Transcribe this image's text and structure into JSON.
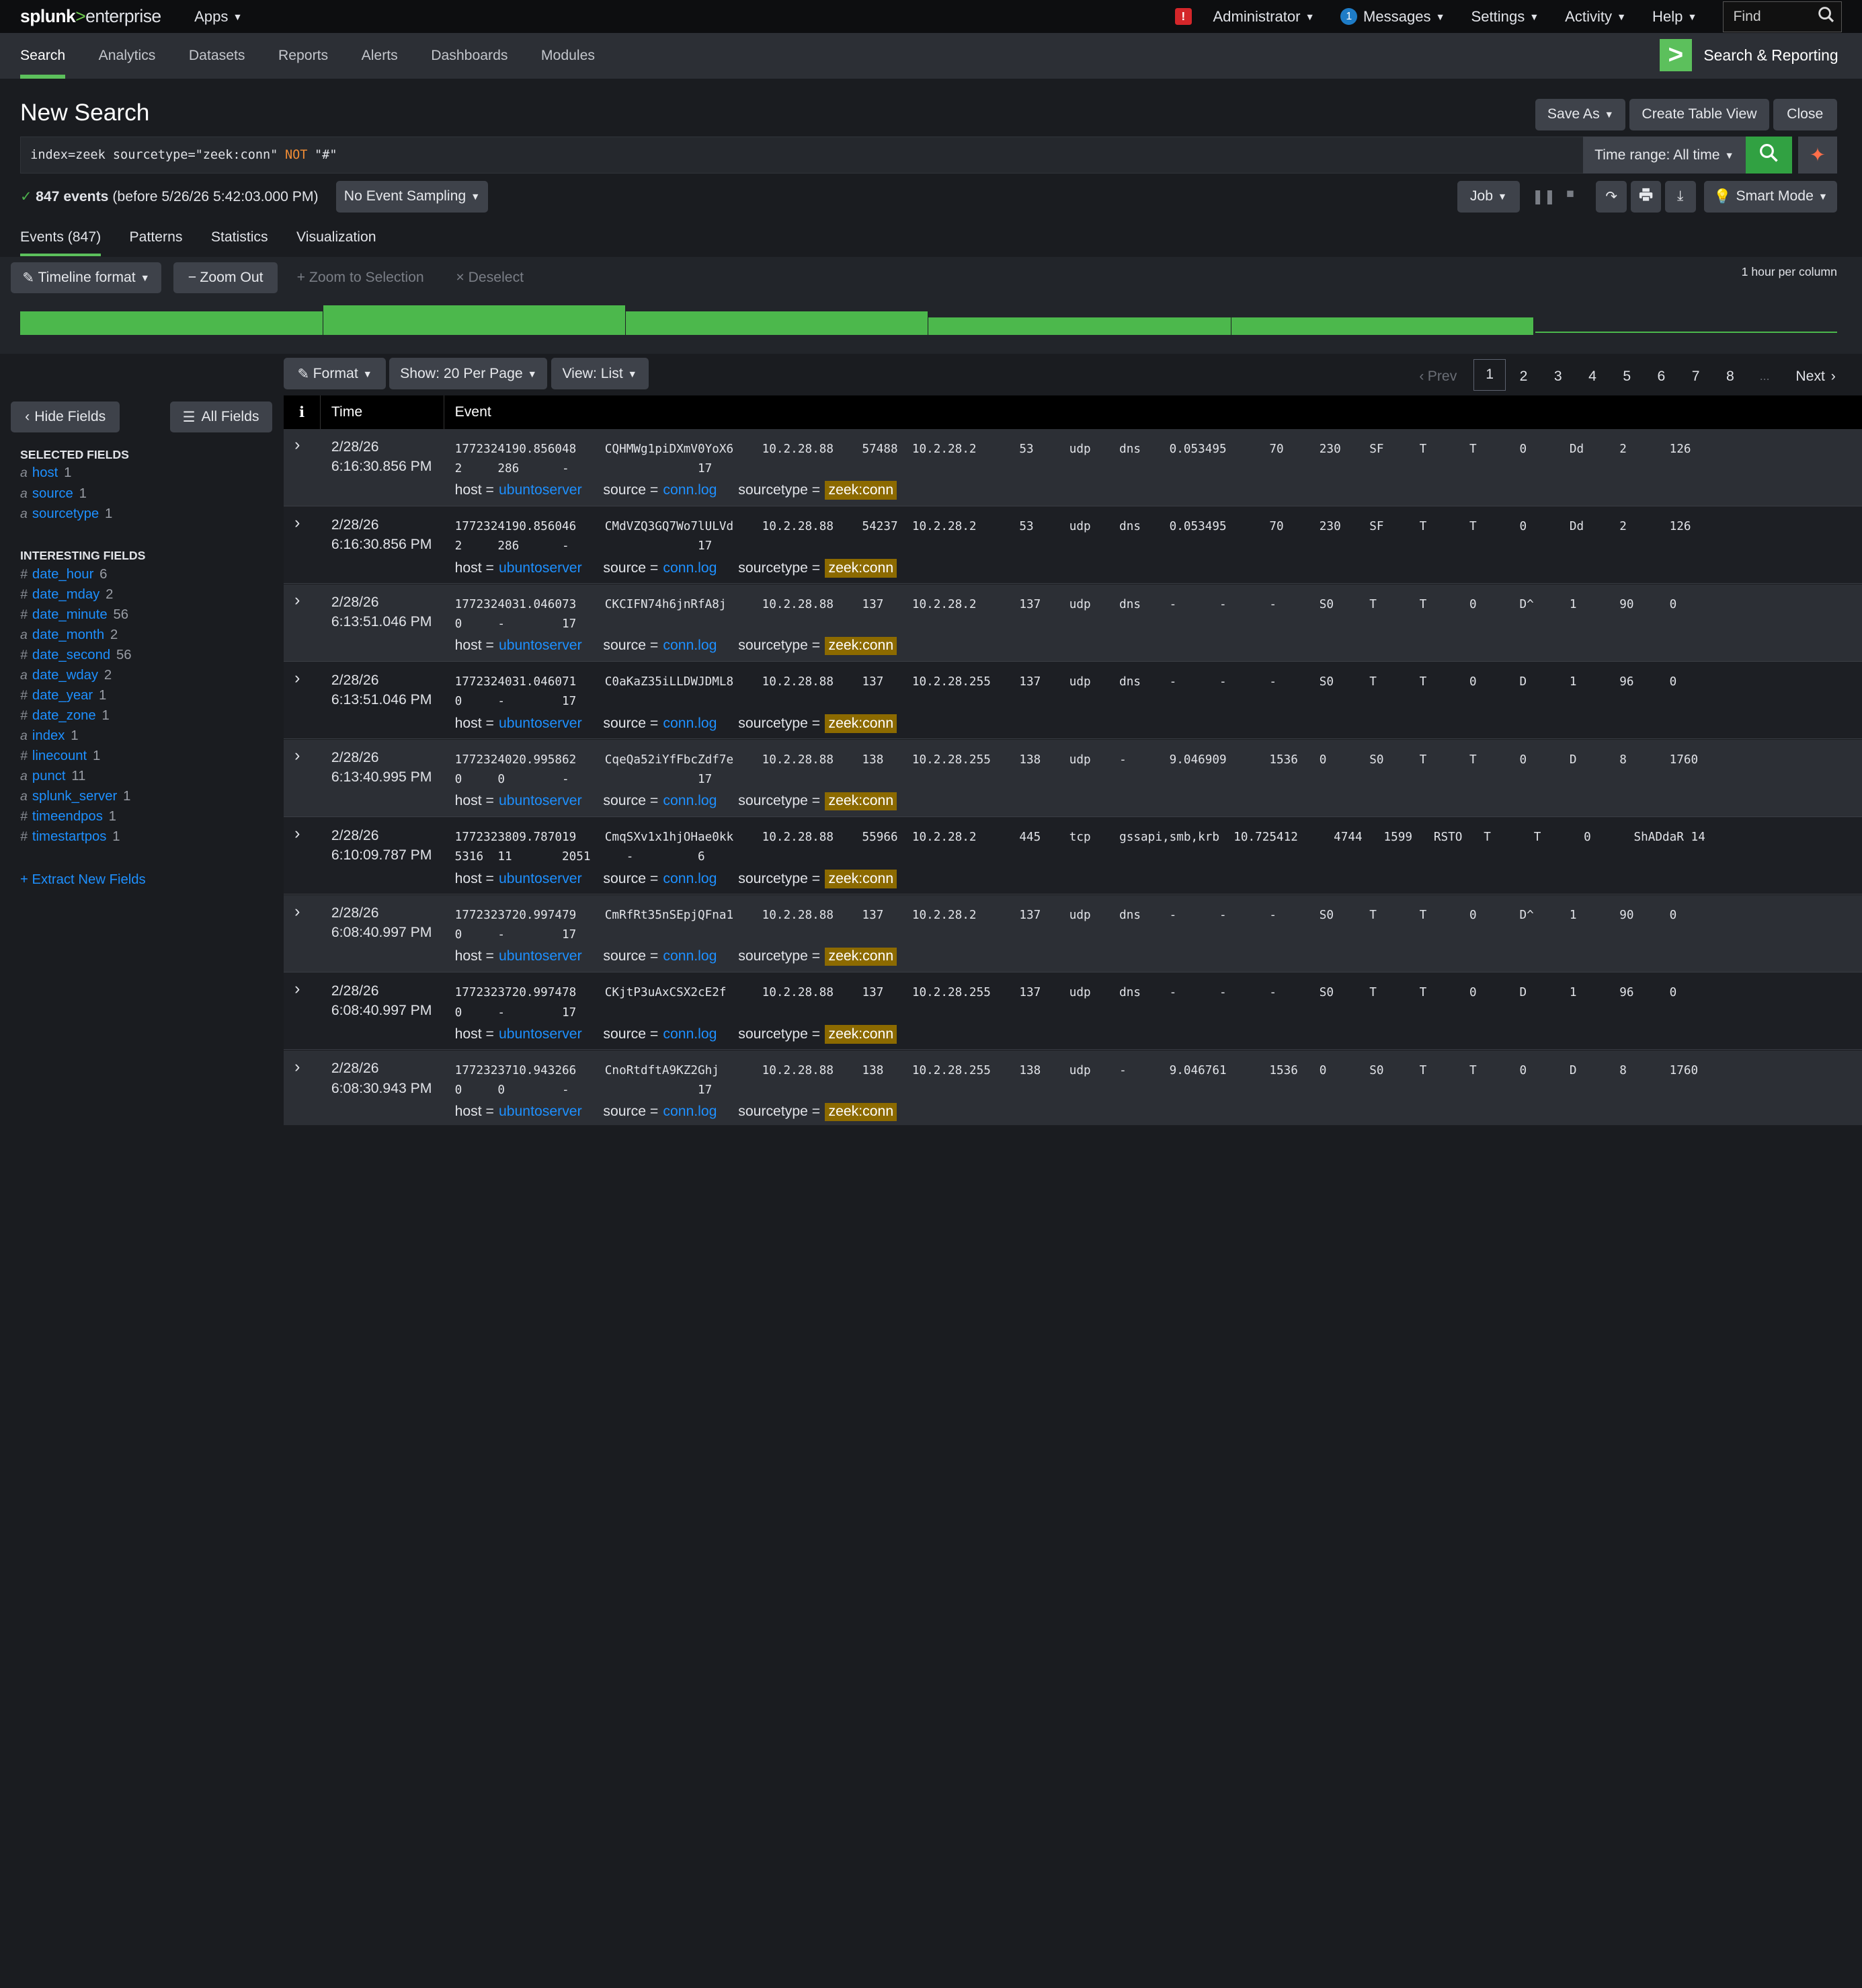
{
  "topbar": {
    "logo_brand": "splunk",
    "logo_sep": ">",
    "logo_product": "enterprise",
    "apps": "Apps",
    "alert_badge": "!",
    "admin": "Administrator",
    "messages_count": "1",
    "messages": "Messages",
    "settings": "Settings",
    "activity": "Activity",
    "help": "Help",
    "find": "Find"
  },
  "nav": {
    "tabs": [
      "Search",
      "Analytics",
      "Datasets",
      "Reports",
      "Alerts",
      "Dashboards",
      "Modules"
    ],
    "app_logo": ">",
    "app_name": "Search & Reporting"
  },
  "page": {
    "title": "New Search",
    "save_as": "Save As",
    "create_table_view": "Create Table View",
    "close": "Close"
  },
  "search": {
    "query_a": "index=zeek sourcetype=\"zeek:conn\"",
    "query_kw": "NOT",
    "query_b": "\"#\"",
    "time_range": "Time range: All time"
  },
  "status": {
    "count": "847 events",
    "detail": "(before 5/26/26 5:42:03.000 PM)",
    "sampling": "No Event Sampling",
    "job": "Job",
    "smart_mode": "Smart Mode"
  },
  "result_tabs": [
    "Events (847)",
    "Patterns",
    "Statistics",
    "Visualization"
  ],
  "timeline": {
    "format": "Timeline format",
    "zoom_out": "Zoom Out",
    "zoom_to_selection": "Zoom to Selection",
    "deselect": "Deselect",
    "hint": "1 hour per column",
    "bar_levels": [
      0.78,
      1.0,
      0.8,
      0.6,
      0.6,
      0.05
    ]
  },
  "pager": {
    "format": "Format",
    "per_page": "Show: 20 Per Page",
    "view": "View: List",
    "prev": "Prev",
    "pages": [
      "1",
      "2",
      "3",
      "4",
      "5",
      "6",
      "7",
      "8"
    ],
    "ellipsis": "...",
    "next": "Next"
  },
  "sidebar": {
    "hide_fields": "Hide Fields",
    "all_fields": "All Fields",
    "selected_header": "SELECTED FIELDS",
    "selected": [
      {
        "type": "a",
        "name": "host",
        "count": "1"
      },
      {
        "type": "a",
        "name": "source",
        "count": "1"
      },
      {
        "type": "a",
        "name": "sourcetype",
        "count": "1"
      }
    ],
    "interesting_header": "INTERESTING FIELDS",
    "interesting": [
      {
        "type": "#",
        "name": "date_hour",
        "count": "6"
      },
      {
        "type": "#",
        "name": "date_mday",
        "count": "2"
      },
      {
        "type": "#",
        "name": "date_minute",
        "count": "56"
      },
      {
        "type": "a",
        "name": "date_month",
        "count": "2"
      },
      {
        "type": "#",
        "name": "date_second",
        "count": "56"
      },
      {
        "type": "a",
        "name": "date_wday",
        "count": "2"
      },
      {
        "type": "#",
        "name": "date_year",
        "count": "1"
      },
      {
        "type": "#",
        "name": "date_zone",
        "count": "1"
      },
      {
        "type": "a",
        "name": "index",
        "count": "1"
      },
      {
        "type": "#",
        "name": "linecount",
        "count": "1"
      },
      {
        "type": "a",
        "name": "punct",
        "count": "11"
      },
      {
        "type": "a",
        "name": "splunk_server",
        "count": "1"
      },
      {
        "type": "#",
        "name": "timeendpos",
        "count": "1"
      },
      {
        "type": "#",
        "name": "timestartpos",
        "count": "1"
      }
    ],
    "extract": "+ Extract New Fields"
  },
  "table": {
    "col_i": "i",
    "col_time": "Time",
    "col_event": "Event",
    "meta_labels": {
      "host": "host =",
      "source": "source =",
      "sourcetype": "sourcetype ="
    },
    "rows": [
      {
        "date": "2/28/26",
        "time": "6:16:30.856 PM",
        "line1": "1772324190.856048    CQHMWg1piDXmV0YoX6    10.2.28.88    57488  10.2.28.2      53     udp    dns    0.053495      70     230    SF     T      T      0      Dd     2      126",
        "line2": "2     286      -                  17",
        "host": "ubuntoserver",
        "source": "conn.log",
        "sourcetype": "zeek:conn"
      },
      {
        "date": "2/28/26",
        "time": "6:16:30.856 PM",
        "line1": "1772324190.856046    CMdVZQ3GQ7Wo7lULVd    10.2.28.88    54237  10.2.28.2      53     udp    dns    0.053495      70     230    SF     T      T      0      Dd     2      126",
        "line2": "2     286      -                  17",
        "host": "ubuntoserver",
        "source": "conn.log",
        "sourcetype": "zeek:conn"
      },
      {
        "date": "2/28/26",
        "time": "6:13:51.046 PM",
        "line1": "1772324031.046073    CKCIFN74h6jnRfA8j     10.2.28.88    137    10.2.28.2      137    udp    dns    -      -      -      S0     T      T      0      D^     1      90     0",
        "line2": "0     -        17",
        "host": "ubuntoserver",
        "source": "conn.log",
        "sourcetype": "zeek:conn"
      },
      {
        "date": "2/28/26",
        "time": "6:13:51.046 PM",
        "line1": "1772324031.046071    C0aKaZ35iLLDWJDML8    10.2.28.88    137    10.2.28.255    137    udp    dns    -      -      -      S0     T      T      0      D      1      96     0",
        "line2": "0     -        17",
        "host": "ubuntoserver",
        "source": "conn.log",
        "sourcetype": "zeek:conn"
      },
      {
        "date": "2/28/26",
        "time": "6:13:40.995 PM",
        "line1": "1772324020.995862    CqeQa52iYfFbcZdf7e    10.2.28.88    138    10.2.28.255    138    udp    -      9.046909      1536   0      S0     T      T      0      D      8      1760",
        "line2": "0     0        -                  17",
        "host": "ubuntoserver",
        "source": "conn.log",
        "sourcetype": "zeek:conn"
      },
      {
        "date": "2/28/26",
        "time": "6:10:09.787 PM",
        "line1": "1772323809.787019    CmqSXv1x1hjOHae0kk    10.2.28.88    55966  10.2.28.2      445    tcp    gssapi,smb,krb  10.725412     4744   1599   RSTO   T      T      0      ShADdaR 14",
        "line2": "5316  11       2051     -         6",
        "host": "ubuntoserver",
        "source": "conn.log",
        "sourcetype": "zeek:conn"
      },
      {
        "date": "2/28/26",
        "time": "6:08:40.997 PM",
        "line1": "1772323720.997479    CmRfRt35nSEpjQFna1    10.2.28.88    137    10.2.28.2      137    udp    dns    -      -      -      S0     T      T      0      D^     1      90     0",
        "line2": "0     -        17",
        "host": "ubuntoserver",
        "source": "conn.log",
        "sourcetype": "zeek:conn"
      },
      {
        "date": "2/28/26",
        "time": "6:08:40.997 PM",
        "line1": "1772323720.997478    CKjtP3uAxCSX2cE2f     10.2.28.88    137    10.2.28.255    137    udp    dns    -      -      -      S0     T      T      0      D      1      96     0",
        "line2": "0     -        17",
        "host": "ubuntoserver",
        "source": "conn.log",
        "sourcetype": "zeek:conn"
      },
      {
        "date": "2/28/26",
        "time": "6:08:30.943 PM",
        "line1": "1772323710.943266    CnoRtdftA9KZ2Ghj      10.2.28.88    138    10.2.28.255    138    udp    -      9.046761      1536   0      S0     T      T      0      D      8      1760",
        "line2": "0     0        -                  17",
        "host": "ubuntoserver",
        "source": "conn.log",
        "sourcetype": "zeek:conn"
      }
    ]
  },
  "colors": {
    "accent": "#5cc05c",
    "link": "#1e90ff",
    "sourcetype_bg": "#8c6a00",
    "search_btn": "#31a142"
  }
}
